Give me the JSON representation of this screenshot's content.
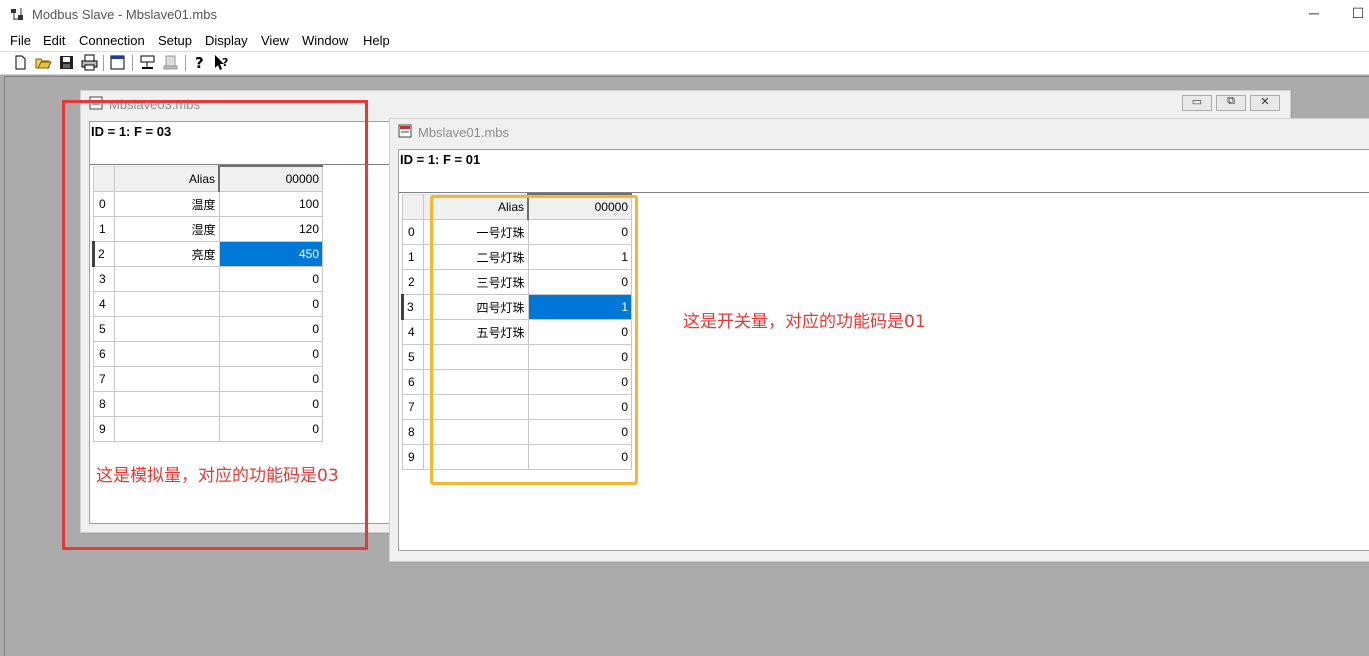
{
  "window": {
    "title": "Modbus Slave - Mbslave01.mbs"
  },
  "menu": [
    "File",
    "Edit",
    "Connection",
    "Setup",
    "Display",
    "View",
    "Window",
    "Help"
  ],
  "toolbar_icons": [
    "new-icon",
    "open-icon",
    "save-icon",
    "print-icon",
    "window-icon",
    "connect-icon",
    "disconnect-icon",
    "help-icon",
    "context-help-icon"
  ],
  "child03": {
    "title": "Mbslave03.mbs",
    "id_line": "ID = 1: F = 03",
    "header": {
      "alias": "Alias",
      "addr": "00000"
    },
    "rows": [
      {
        "n": "0",
        "alias": "温度",
        "value": "100"
      },
      {
        "n": "1",
        "alias": "湿度",
        "value": "120"
      },
      {
        "n": "2",
        "alias": "亮度",
        "value": "450"
      },
      {
        "n": "3",
        "alias": "",
        "value": "0"
      },
      {
        "n": "4",
        "alias": "",
        "value": "0"
      },
      {
        "n": "5",
        "alias": "",
        "value": "0"
      },
      {
        "n": "6",
        "alias": "",
        "value": "0"
      },
      {
        "n": "7",
        "alias": "",
        "value": "0"
      },
      {
        "n": "8",
        "alias": "",
        "value": "0"
      },
      {
        "n": "9",
        "alias": "",
        "value": "0"
      }
    ],
    "selected_row": 2
  },
  "child01": {
    "title": "Mbslave01.mbs",
    "id_line": "ID = 1: F = 01",
    "header": {
      "alias": "Alias",
      "addr": "00000"
    },
    "rows": [
      {
        "n": "0",
        "alias": "一号灯珠",
        "value": "0"
      },
      {
        "n": "1",
        "alias": "二号灯珠",
        "value": "1"
      },
      {
        "n": "2",
        "alias": "三号灯珠",
        "value": "0"
      },
      {
        "n": "3",
        "alias": "四号灯珠",
        "value": "1"
      },
      {
        "n": "4",
        "alias": "五号灯珠",
        "value": "0"
      },
      {
        "n": "5",
        "alias": "",
        "value": "0"
      },
      {
        "n": "6",
        "alias": "",
        "value": "0"
      },
      {
        "n": "7",
        "alias": "",
        "value": "0"
      },
      {
        "n": "8",
        "alias": "",
        "value": "0"
      },
      {
        "n": "9",
        "alias": "",
        "value": "0"
      }
    ],
    "selected_row": 3
  },
  "annotations": {
    "analog": "这是模拟量，对应的功能码是03",
    "coil": "这是开关量，对应的功能码是01"
  },
  "colors": {
    "selection": "#0078d7",
    "annotation_red": "#e53935",
    "annotation_yellow": "#f5b731"
  }
}
